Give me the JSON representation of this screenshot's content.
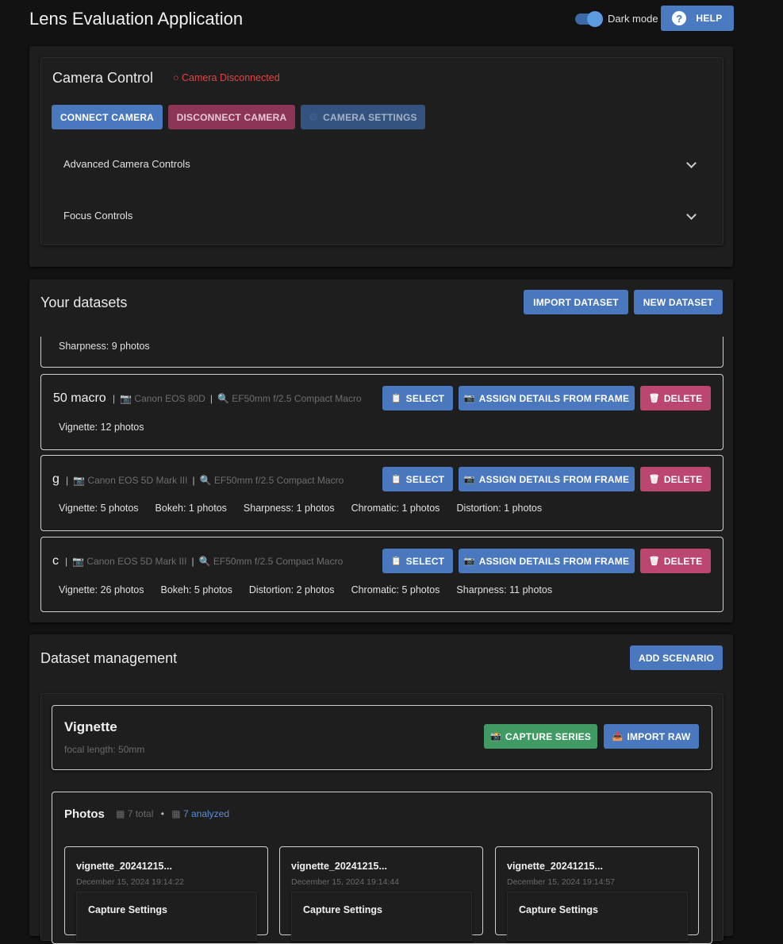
{
  "app": {
    "title": "Lens Evaluation Application",
    "dark_mode_label": "Dark mode",
    "help_label": "HELP"
  },
  "camera": {
    "title": "Camera Control",
    "status": "○ Camera Disconnected",
    "connect_label": "CONNECT CAMERA",
    "disconnect_label": "DISCONNECT CAMERA",
    "settings_label": "CAMERA SETTINGS",
    "advanced_label": "Advanced Camera Controls",
    "focus_label": "Focus Controls"
  },
  "datasets": {
    "title": "Your datasets",
    "import_label": "IMPORT DATASET",
    "new_label": "NEW DATASET",
    "partial_stats": "Sharpness: 9 photos",
    "select_label": "SELECT",
    "assign_label": "ASSIGN DETAILS FROM FRAME",
    "delete_label": "DELETE",
    "items": [
      {
        "name": "50 macro",
        "camera": "Canon EOS 80D",
        "lens": "EF50mm f/2.5 Compact Macro",
        "stats": [
          "Vignette: 12 photos"
        ]
      },
      {
        "name": "g",
        "camera": "Canon EOS 5D Mark III",
        "lens": "EF50mm f/2.5 Compact Macro",
        "stats": [
          "Vignette: 5 photos",
          "Bokeh: 1 photos",
          "Sharpness: 1 photos",
          "Chromatic: 1 photos",
          "Distortion: 1 photos"
        ]
      },
      {
        "name": "c",
        "camera": "Canon EOS 5D Mark III",
        "lens": "EF50mm f/2.5 Compact Macro",
        "stats": [
          "Vignette: 26 photos",
          "Bokeh: 5 photos",
          "Distortion: 2 photos",
          "Chromatic: 5 photos",
          "Sharpness: 11 photos"
        ]
      }
    ]
  },
  "management": {
    "title": "Dataset management",
    "add_scenario_label": "ADD SCENARIO",
    "scenario": {
      "title": "Vignette",
      "subtitle": "focal length: 50mm",
      "capture_label": "CAPTURE SERIES",
      "import_raw_label": "IMPORT RAW"
    },
    "photos": {
      "title": "Photos",
      "total": "7 total",
      "bullet": "•",
      "analyzed": "7 analyzed",
      "items": [
        {
          "name": "vignette_20241215...",
          "date": "December 15, 2024 19:14:22",
          "section": "Capture Settings"
        },
        {
          "name": "vignette_20241215...",
          "date": "December 15, 2024 19:14:44",
          "section": "Capture Settings"
        },
        {
          "name": "vignette_20241215...",
          "date": "December 15, 2024 19:14:57",
          "section": "Capture Settings"
        }
      ]
    }
  },
  "colors": {
    "background": "#121212",
    "panel": "#1e1e1e",
    "primary": "#4a78bf",
    "danger": "#bb4670",
    "success": "#3f9a63",
    "status_disconnected": "#e04545",
    "link": "#5b8fd6"
  },
  "icons": {
    "help": "?",
    "camera": "📷",
    "lens": "🔍",
    "select": "📋",
    "delete": "🗑",
    "capture": "📸",
    "import": "📥",
    "photos": "▦"
  }
}
